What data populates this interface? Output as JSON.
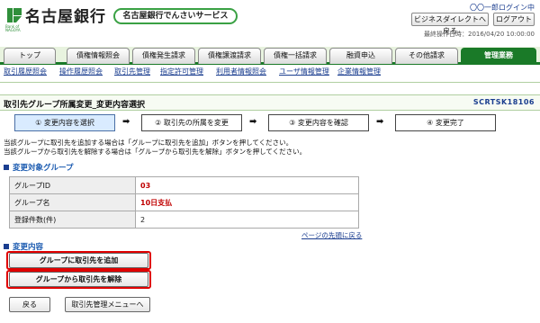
{
  "header": {
    "bank_name": "名古屋銀行",
    "bank_sub_line1": "Bank of",
    "bank_sub_line2": "NAGOYA",
    "service_name": "名古屋銀行でんさいサービス",
    "user_name": "〇〇一郎ログイン中",
    "direct_button": "ビジネスダイレクトへ戻る",
    "logout_button": "ログアウト",
    "last_operation": "最終操作日時：2016/04/20 10:00:00",
    "brand_color": "#1a7a28"
  },
  "tabs": [
    {
      "label": "トップ",
      "active": false
    },
    {
      "label": "債権情報照会",
      "active": false
    },
    {
      "label": "債権発生請求",
      "active": false
    },
    {
      "label": "債権譲渡請求",
      "active": false
    },
    {
      "label": "債権一括請求",
      "active": false
    },
    {
      "label": "融資申込",
      "active": false
    },
    {
      "label": "その他請求",
      "active": false
    },
    {
      "label": "管理業務",
      "active": true
    }
  ],
  "subnav": [
    "取引履歴照会",
    "操作履歴照会",
    "取引先管理",
    "指定許可管理",
    "利用者情報照会",
    "ユーザ情報管理",
    "企業情報管理"
  ],
  "page": {
    "title": "取引先グループ所属変更_変更内容選択",
    "screen_id": "SCRTSK18106"
  },
  "steps": [
    {
      "label": "① 変更内容を選択",
      "current": true
    },
    {
      "label": "② 取引先の所属を変更",
      "current": false
    },
    {
      "label": "③ 変更内容を確認",
      "current": false
    },
    {
      "label": "④ 変更完了",
      "current": false
    }
  ],
  "step_arrow": "➡",
  "notes": [
    "当該グループに取引先を追加する場合は「グループに取引先を追加」ボタンを押してください。",
    "当該グループから取引先を解除する場合は「グループから取引先を解除」ボタンを押してください。"
  ],
  "group_section": {
    "title": "変更対象グループ",
    "rows": [
      {
        "label": "グループID",
        "value": "03",
        "emphasis": true
      },
      {
        "label": "グループ名",
        "value": "10日支払",
        "emphasis": true
      },
      {
        "label": "登録件数(件)",
        "value": "2",
        "emphasis": false
      }
    ],
    "page_top_link": "ページの先頭に戻る"
  },
  "change_section": {
    "title": "変更内容",
    "add_button": "グループに取引先を追加",
    "remove_button": "グループから取引先を解除"
  },
  "footer": {
    "back_button": "戻る",
    "menu_button": "取引先管理メニューへ"
  }
}
